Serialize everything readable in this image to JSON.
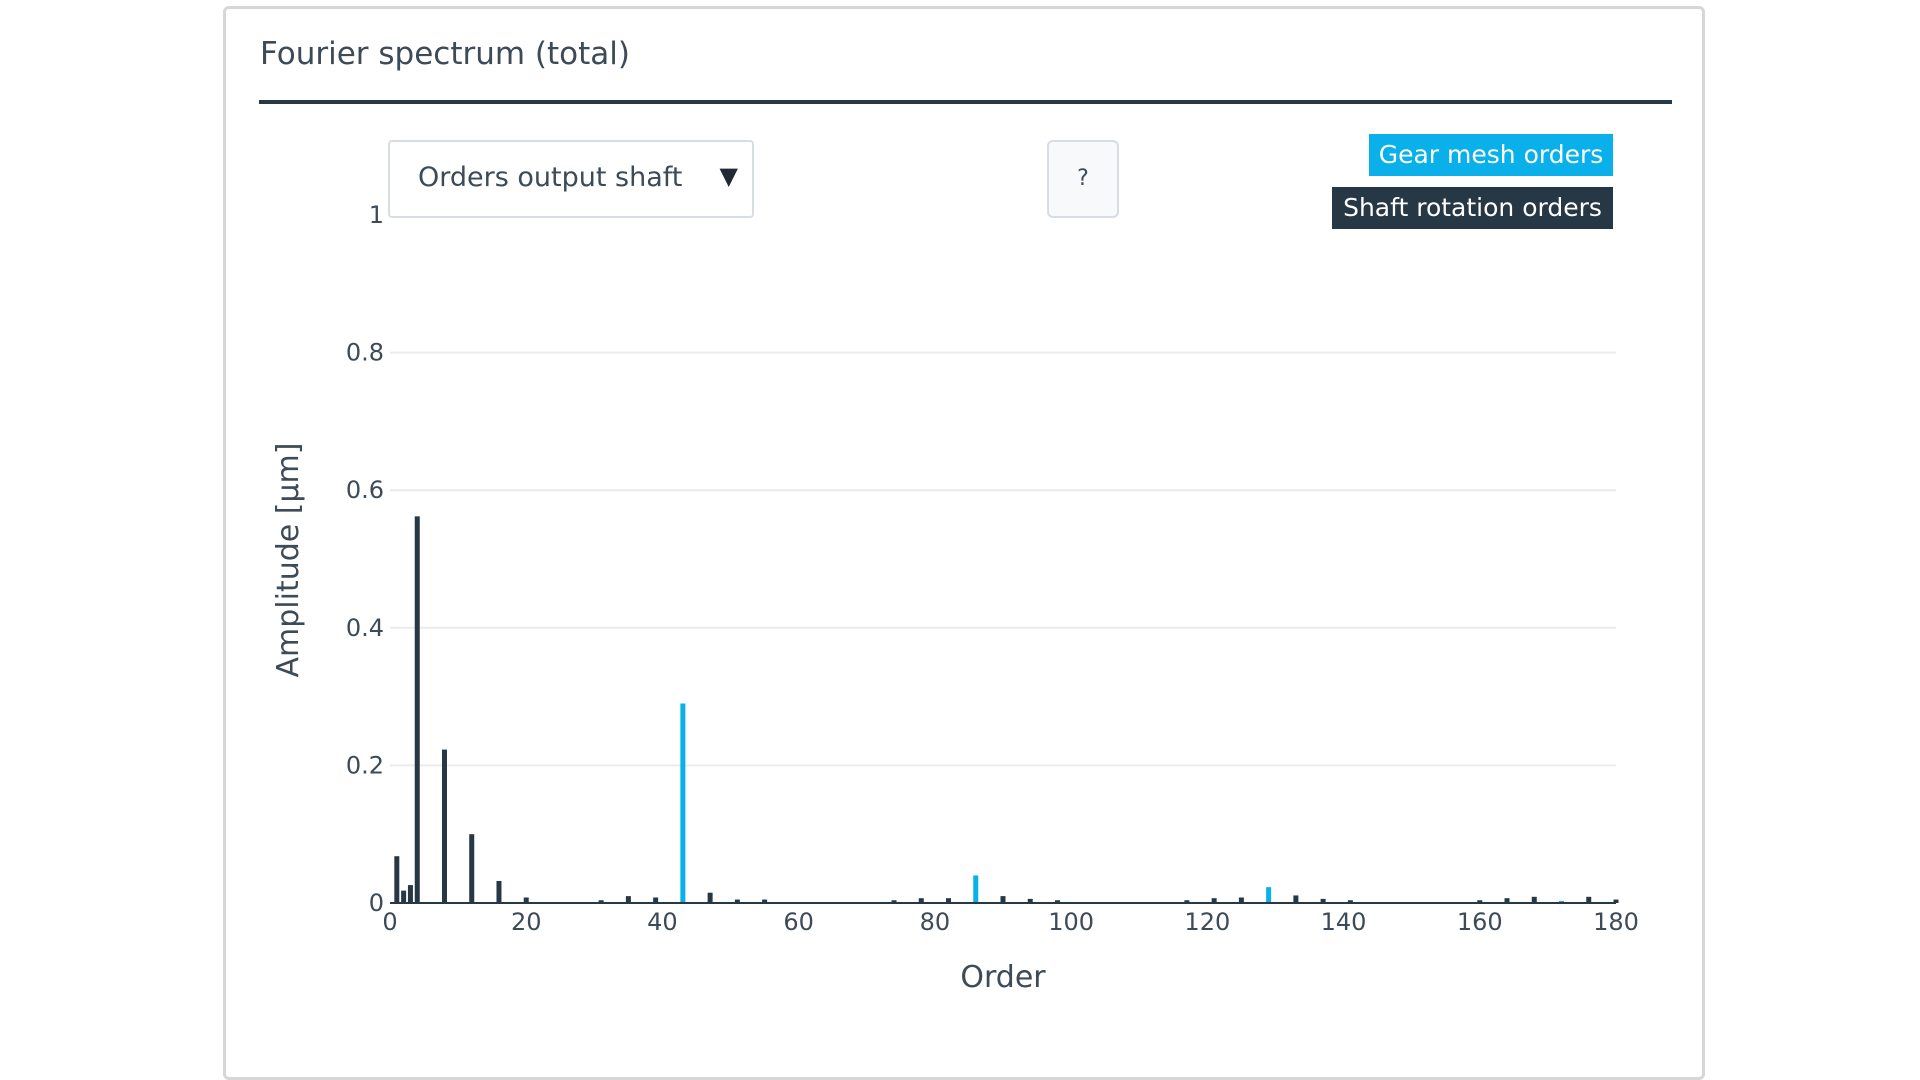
{
  "panel": {
    "title": "Fourier spectrum (total)"
  },
  "controls": {
    "dropdown_label": "Orders output shaft",
    "dropdown_arrow": "▼",
    "help_label": "?"
  },
  "colors": {
    "gear_mesh": "#09b0ea",
    "shaft_rotation": "#263746",
    "grid": "#ececec",
    "axis": "#283845"
  },
  "chart_data": {
    "type": "bar",
    "xlabel": "Order",
    "ylabel": "Amplitude [µm]",
    "xlim": [
      0,
      180
    ],
    "ylim": [
      0,
      1
    ],
    "xticks": [
      0,
      20,
      40,
      60,
      80,
      100,
      120,
      140,
      160,
      180
    ],
    "yticks": [
      0,
      0.2,
      0.4,
      0.6,
      0.8,
      1
    ],
    "ytick_labels": [
      "0",
      "0.2",
      "0.4",
      "0.6",
      "0.8",
      "1"
    ],
    "gridlines": [
      0.2,
      0.4,
      0.6,
      0.8
    ],
    "legend_position": "top-right",
    "series": [
      {
        "name": "Gear mesh orders",
        "color": "#09b0ea",
        "x": [
          43,
          86,
          129,
          172
        ],
        "values": [
          0.29,
          0.04,
          0.023,
          0.003
        ]
      },
      {
        "name": "Shaft rotation orders",
        "color": "#263746",
        "x": [
          1,
          2,
          3,
          4,
          8,
          12,
          16,
          20,
          31,
          35,
          39,
          47,
          51,
          55,
          74,
          78,
          82,
          90,
          94,
          98,
          117,
          121,
          125,
          133,
          137,
          141,
          160,
          164,
          168,
          176,
          180
        ],
        "values": [
          0.068,
          0.018,
          0.026,
          0.562,
          0.223,
          0.1,
          0.032,
          0.008,
          0.004,
          0.01,
          0.008,
          0.015,
          0.005,
          0.005,
          0.004,
          0.007,
          0.007,
          0.01,
          0.006,
          0.004,
          0.004,
          0.007,
          0.008,
          0.011,
          0.006,
          0.004,
          0.004,
          0.007,
          0.009,
          0.009,
          0.005
        ]
      }
    ]
  }
}
